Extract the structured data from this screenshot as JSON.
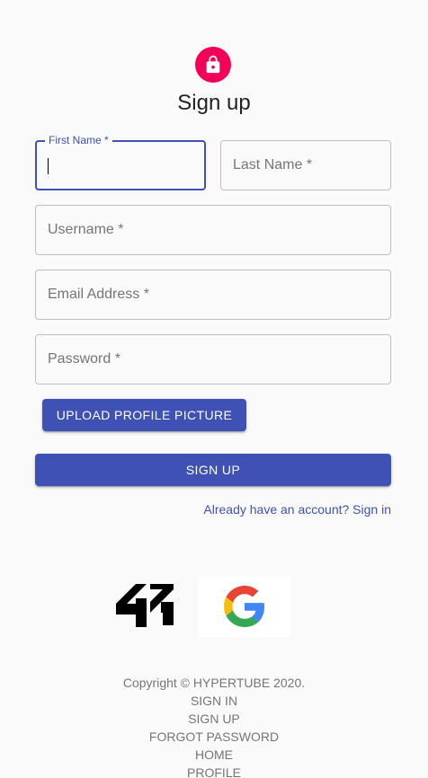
{
  "header": {
    "title": "Sign up",
    "icon": "lock-icon",
    "icon_color": "#f50057"
  },
  "form": {
    "first_name_label": "First Name *",
    "last_name_label": "Last Name *",
    "username_label": "Username *",
    "email_label": "Email Address *",
    "password_label": "Password *",
    "upload_label": "UPLOAD PROFILE PICTURE",
    "submit_label": "SIGN UP",
    "signin_link": "Already have an account? Sign in",
    "accent_color": "#3f51b5"
  },
  "oauth": {
    "providers": [
      "42-logo-icon",
      "google-logo-icon"
    ]
  },
  "footer": {
    "copyright": "Copyright © HYPERTUBE 2020.",
    "links": [
      "SIGN IN",
      "SIGN UP",
      "FORGOT PASSWORD",
      "HOME",
      "PROFILE"
    ]
  }
}
